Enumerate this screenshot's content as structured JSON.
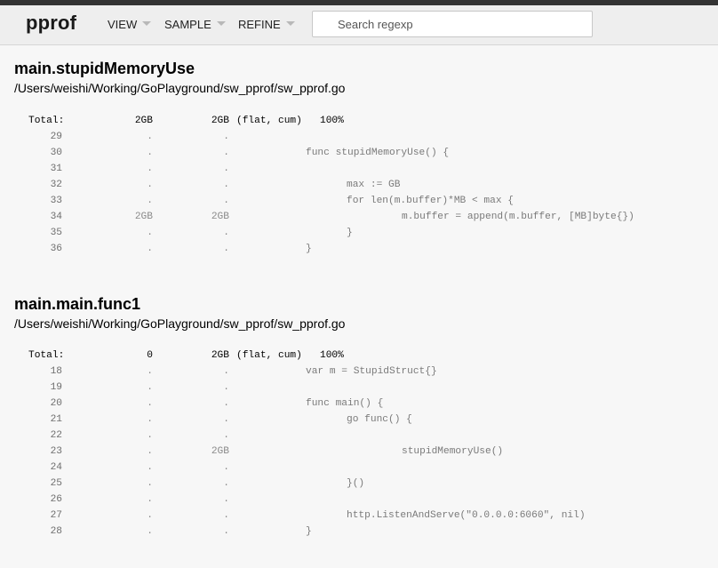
{
  "header": {
    "logo": "pprof",
    "menus": [
      "VIEW",
      "SAMPLE",
      "REFINE"
    ],
    "search_placeholder": "Search regexp"
  },
  "sections": [
    {
      "title": "main.stupidMemoryUse",
      "path": "/Users/weishi/Working/GoPlayground/sw_pprof/sw_pprof.go",
      "total": {
        "label": "Total:",
        "flat": "2GB",
        "cum": "2GB",
        "suffix": "(flat, cum)   100%"
      },
      "lines": [
        {
          "num": "29",
          "flat": ".",
          "cum": ".",
          "code": ""
        },
        {
          "num": "30",
          "flat": ".",
          "cum": ".",
          "code": "func stupidMemoryUse() {"
        },
        {
          "num": "31",
          "flat": ".",
          "cum": ".",
          "code": ""
        },
        {
          "num": "32",
          "flat": ".",
          "cum": ".",
          "code": "max := GB"
        },
        {
          "num": "33",
          "flat": ".",
          "cum": ".",
          "code": "for len(m.buffer)*MB < max {"
        },
        {
          "num": "34",
          "flat": "2GB",
          "cum": "2GB",
          "code": "m.buffer = append(m.buffer, [MB]byte{})"
        },
        {
          "num": "35",
          "flat": ".",
          "cum": ".",
          "code": "}"
        },
        {
          "num": "36",
          "flat": ".",
          "cum": ".",
          "code": "}"
        }
      ]
    },
    {
      "title": "main.main.func1",
      "path": "/Users/weishi/Working/GoPlayground/sw_pprof/sw_pprof.go",
      "total": {
        "label": "Total:",
        "flat": "0",
        "cum": "2GB",
        "suffix": "(flat, cum)   100%"
      },
      "lines": [
        {
          "num": "18",
          "flat": ".",
          "cum": ".",
          "code": "var m = StupidStruct{}"
        },
        {
          "num": "19",
          "flat": ".",
          "cum": ".",
          "code": ""
        },
        {
          "num": "20",
          "flat": ".",
          "cum": ".",
          "code": "func main() {"
        },
        {
          "num": "21",
          "flat": ".",
          "cum": ".",
          "code": "go func() {"
        },
        {
          "num": "22",
          "flat": ".",
          "cum": ".",
          "code": ""
        },
        {
          "num": "23",
          "flat": ".",
          "cum": "2GB",
          "code": "stupidMemoryUse()"
        },
        {
          "num": "24",
          "flat": ".",
          "cum": ".",
          "code": ""
        },
        {
          "num": "25",
          "flat": ".",
          "cum": ".",
          "code": "}()"
        },
        {
          "num": "26",
          "flat": ".",
          "cum": ".",
          "code": ""
        },
        {
          "num": "27",
          "flat": ".",
          "cum": ".",
          "code": "http.ListenAndServe(\"0.0.0.0:6060\", nil)"
        },
        {
          "num": "28",
          "flat": ".",
          "cum": ".",
          "code": "}"
        }
      ]
    }
  ]
}
